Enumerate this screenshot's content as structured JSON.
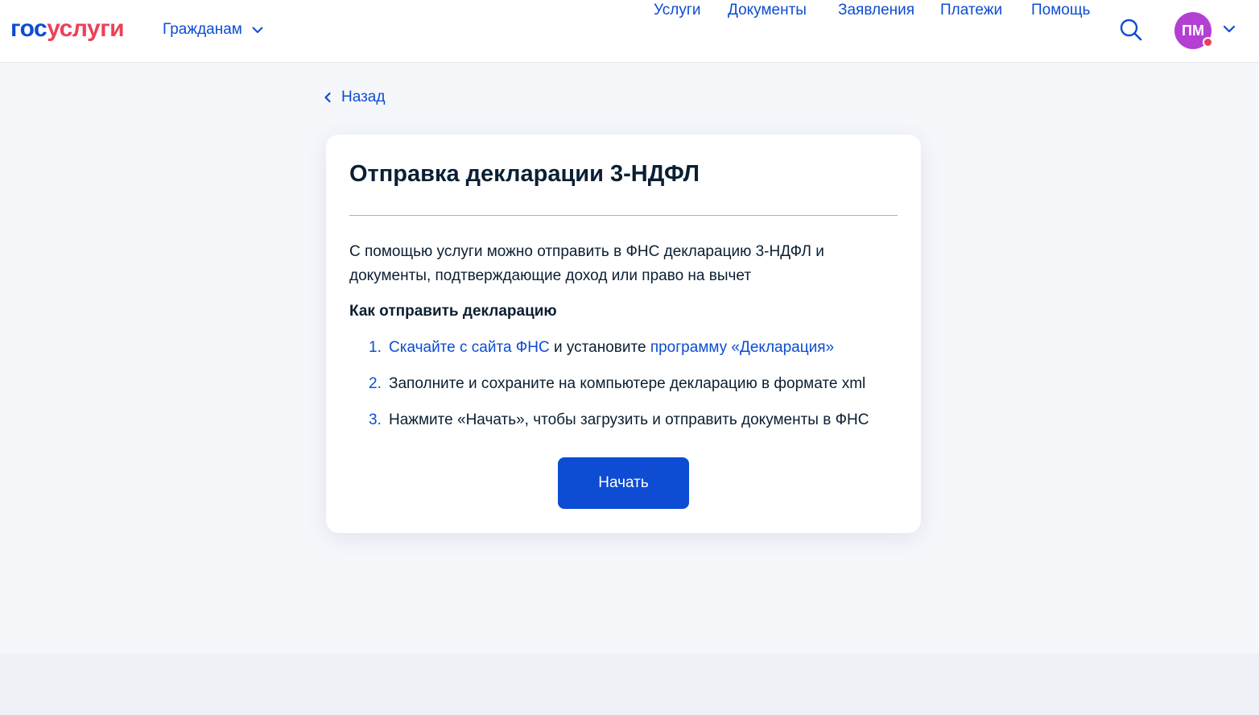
{
  "header": {
    "logo": {
      "part1": "гос",
      "part2": "услуги"
    },
    "audience_label": "Гражданам",
    "nav": [
      {
        "label": "Услуги"
      },
      {
        "label": "Документы"
      },
      {
        "label": "Заявления"
      },
      {
        "label": "Платежи"
      },
      {
        "label": "Помощь"
      }
    ],
    "search_icon": "search-icon",
    "avatar_initials": "ПМ"
  },
  "back_label": "Назад",
  "card": {
    "title": "Отправка декларации 3-НДФЛ",
    "description": "С помощью услуги можно отправить в ФНС декларацию 3-НДФЛ и документы, подтверждающие доход или право на вычет",
    "subheading": "Как отправить декларацию",
    "steps": [
      {
        "num": "1.",
        "link1": "Скачайте с сайта ФНС",
        "middle": " и установите ",
        "link2": "программу «Декларация»"
      },
      {
        "num": "2.",
        "text": "Заполните и сохраните на компьютере декларацию в формате xml"
      },
      {
        "num": "3.",
        "text": "Нажмите «Начать», чтобы загрузить и отправить документы в ФНС"
      }
    ],
    "start_button": "Начать"
  },
  "colors": {
    "primary": "#0d4cd3",
    "logo_accent": "#ee3f58",
    "avatar": "#b43fd5",
    "text": "#0b1f33",
    "page_bg": "#f5f7fb"
  }
}
